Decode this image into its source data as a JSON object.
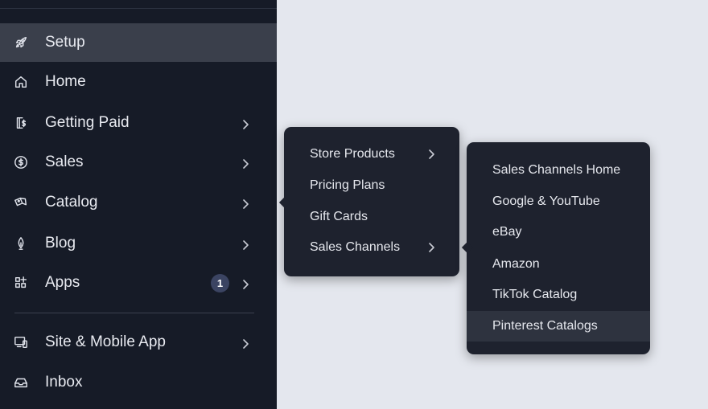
{
  "sidebar": {
    "items": [
      {
        "label": "Setup",
        "icon": "rocket-icon",
        "chevron": false,
        "active": true
      },
      {
        "label": "Home",
        "icon": "home-icon",
        "chevron": false
      },
      {
        "label": "Getting Paid",
        "icon": "payment-icon",
        "chevron": true
      },
      {
        "label": "Sales",
        "icon": "dollar-circle-icon",
        "chevron": true
      },
      {
        "label": "Catalog",
        "icon": "catalog-icon",
        "chevron": true
      },
      {
        "label": "Blog",
        "icon": "pen-nib-icon",
        "chevron": true
      },
      {
        "label": "Apps",
        "icon": "apps-icon",
        "chevron": true,
        "badge": "1"
      },
      {
        "label": "Site & Mobile App",
        "icon": "devices-icon",
        "chevron": true
      },
      {
        "label": "Inbox",
        "icon": "inbox-icon",
        "chevron": false
      }
    ]
  },
  "catalog_menu": {
    "items": [
      {
        "label": "Store Products",
        "chevron": true
      },
      {
        "label": "Pricing Plans",
        "chevron": false
      },
      {
        "label": "Gift Cards",
        "chevron": false
      },
      {
        "label": "Sales Channels",
        "chevron": true
      }
    ]
  },
  "sales_channels_menu": {
    "items": [
      {
        "label": "Sales Channels Home"
      },
      {
        "label": "Google & YouTube"
      },
      {
        "label": "eBay"
      },
      {
        "label": "Amazon"
      },
      {
        "label": "TikTok Catalog"
      },
      {
        "label": "Pinterest Catalogs",
        "hovered": true
      }
    ]
  },
  "colors": {
    "sidebar_bg": "#161b27",
    "active_bg": "#3a3f4b",
    "menu_bg": "#1e222e",
    "badge_bg": "#3b4462",
    "page_bg": "#e4e7ee"
  }
}
